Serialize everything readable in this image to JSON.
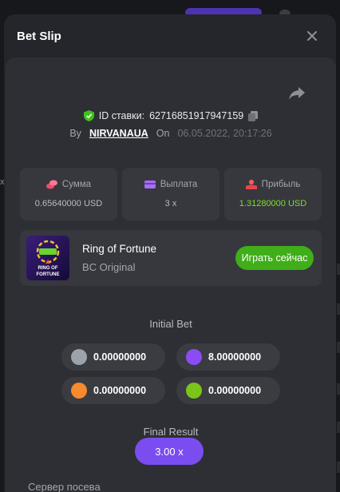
{
  "modal": {
    "title": "Bet Slip",
    "close_icon": "close-icon",
    "share_icon": "share-icon"
  },
  "bet": {
    "id_label": "ID ставки:",
    "id_value": "62716851917947159",
    "by_label": "By",
    "username": "NIRVANAUA",
    "on_label": "On",
    "datetime": "06.05.2022, 20:17:26"
  },
  "stats": [
    {
      "icon": "coins-icon",
      "label": "Сумма",
      "value": "0.65640000 USD",
      "color": "#b9bbc1"
    },
    {
      "icon": "wallet-icon",
      "label": "Выплата",
      "value": "3 x",
      "color": "#b9bbc1"
    },
    {
      "icon": "profit-icon",
      "label": "Прибыль",
      "value": "1.31280000 USD",
      "color": "#7fdc2a"
    }
  ],
  "game": {
    "name": "Ring of Fortune",
    "provider": "BC Original",
    "play_label": "Играть сейчас",
    "thumb_text": "RING OF FORTUNE"
  },
  "initial_bet": {
    "title": "Initial Bet",
    "coins": [
      {
        "color": "#9ea3ab",
        "value": "0.00000000"
      },
      {
        "color": "#8b4cf3",
        "value": "8.00000000"
      },
      {
        "color": "#f58a2e",
        "value": "0.00000000"
      },
      {
        "color": "#7bc518",
        "value": "0.00000000"
      }
    ]
  },
  "final_result": {
    "title": "Final Result",
    "value": "3.00 x"
  },
  "seed": {
    "label": "Сервер посева"
  },
  "colors": {
    "accent_green": "#3fae18",
    "accent_purple": "#7b4df0"
  }
}
